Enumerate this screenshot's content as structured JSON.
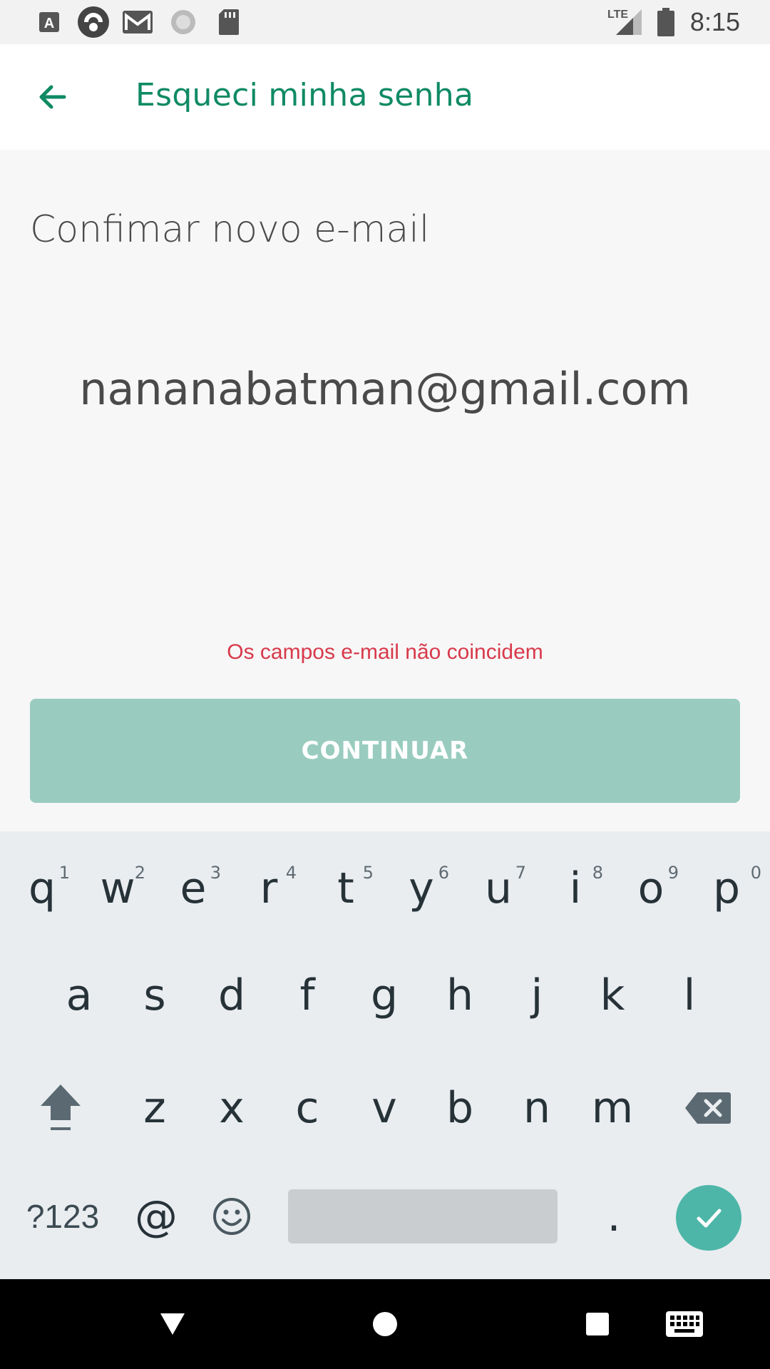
{
  "status_bar": {
    "time": "8:15",
    "network": "LTE",
    "icons": [
      "text-a-icon",
      "blue-circle-app-icon",
      "gmail-icon",
      "loading-circle-icon",
      "sd-card-icon",
      "signal-icon",
      "battery-icon"
    ]
  },
  "app_bar": {
    "title": "Esqueci minha senha",
    "back_icon": "arrow-left-icon"
  },
  "form": {
    "label": "Confimar novo e-mail",
    "email_value": "nananabatman@gmail.com",
    "error": "Os campos e-mail não coincidem",
    "continue_label": "CONTINUAR"
  },
  "keyboard": {
    "row1": [
      {
        "key": "q",
        "hint": "1"
      },
      {
        "key": "w",
        "hint": "2"
      },
      {
        "key": "e",
        "hint": "3"
      },
      {
        "key": "r",
        "hint": "4"
      },
      {
        "key": "t",
        "hint": "5"
      },
      {
        "key": "y",
        "hint": "6"
      },
      {
        "key": "u",
        "hint": "7"
      },
      {
        "key": "i",
        "hint": "8"
      },
      {
        "key": "o",
        "hint": "9"
      },
      {
        "key": "p",
        "hint": "0"
      }
    ],
    "row2": [
      "a",
      "s",
      "d",
      "f",
      "g",
      "h",
      "j",
      "k",
      "l"
    ],
    "row3": [
      "z",
      "x",
      "c",
      "v",
      "b",
      "n",
      "m"
    ],
    "symbols_label": "?123",
    "at_label": "@",
    "period_label": "."
  },
  "colors": {
    "accent": "#0f8a64",
    "button_disabled": "#99ccbe",
    "error": "#d8394a",
    "enter_key": "#4db6a8"
  }
}
